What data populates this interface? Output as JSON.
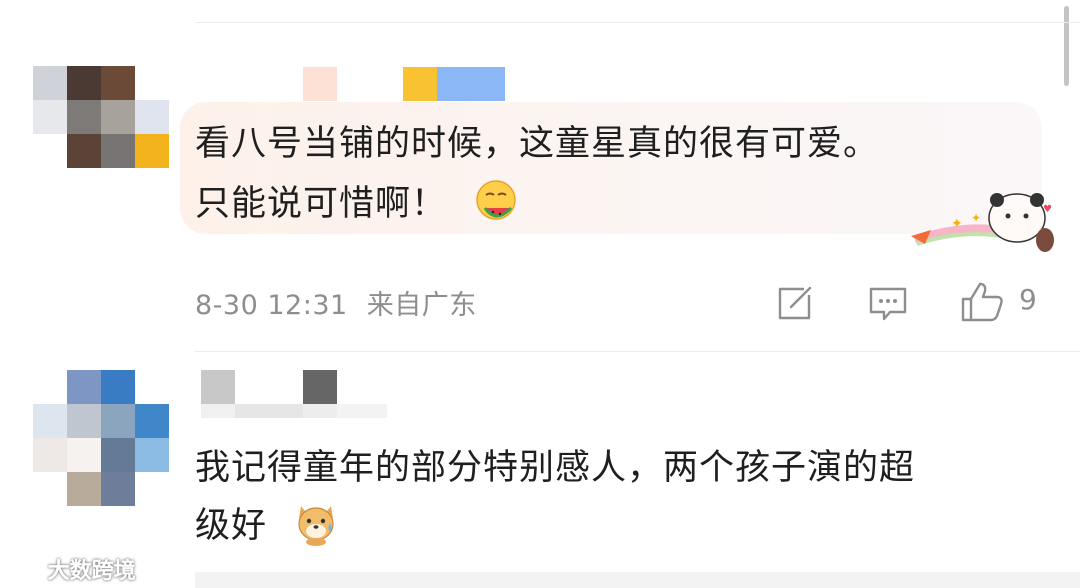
{
  "comments": [
    {
      "text_line1": "看八号当铺的时候，这童星真的很有可爱。",
      "text_line2": "只能说可惜啊！",
      "emoji": "watermelon-face-emoji",
      "timestamp": "8-30 12:31",
      "location": "来自广东",
      "like_count": "9",
      "icons": [
        "share-icon",
        "comment-icon",
        "like-icon"
      ]
    },
    {
      "text_line1": "我记得童年的部分特别感人，两个孩子演的超",
      "text_line2": "级好",
      "emoji": "crying-dog-emoji"
    }
  ],
  "watermark": "大数跨境",
  "colors": {
    "bubble_start": "#fdf1ea",
    "meta_text": "#8e8e8e",
    "divider": "#ececec"
  }
}
